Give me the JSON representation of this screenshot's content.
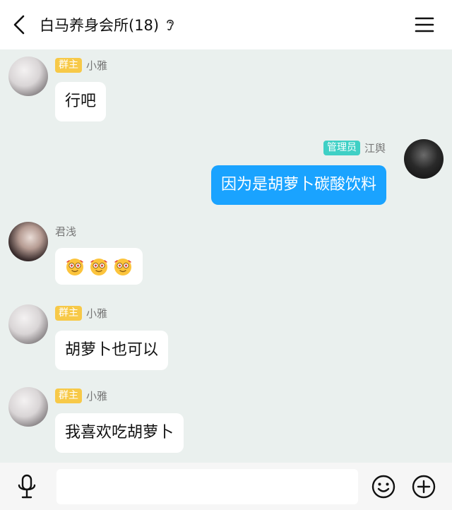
{
  "header": {
    "title": "白马养身会所(18)",
    "back_icon": "chevron-left-icon",
    "ear_icon": "ear-icon",
    "menu_icon": "hamburger-menu-icon"
  },
  "messages": [
    {
      "sender": "小雅",
      "badge": "群主",
      "text": "行吧",
      "side": "left"
    },
    {
      "sender": "江舆",
      "badge": "管理员",
      "text": "因为是胡萝卜碳酸饮料",
      "side": "right"
    },
    {
      "sender": "君浅",
      "badge": "",
      "text": "",
      "emoji_count": 3,
      "emoji_icon": "starry-eyed-face-icon",
      "side": "left"
    },
    {
      "sender": "小雅",
      "badge": "群主",
      "text": "胡萝卜也可以",
      "side": "left"
    },
    {
      "sender": "小雅",
      "badge": "群主",
      "text": "我喜欢吃胡萝卜",
      "side": "left"
    }
  ],
  "input_bar": {
    "mic_icon": "microphone-icon",
    "input_value": "",
    "emoji_icon": "smiley-icon",
    "plus_icon": "plus-circle-icon"
  },
  "colors": {
    "chat_background": "#eaf0ee",
    "my_bubble": "#1aa3ff",
    "owner_badge": "#f7c948",
    "admin_badge": "#3fd0c5"
  }
}
